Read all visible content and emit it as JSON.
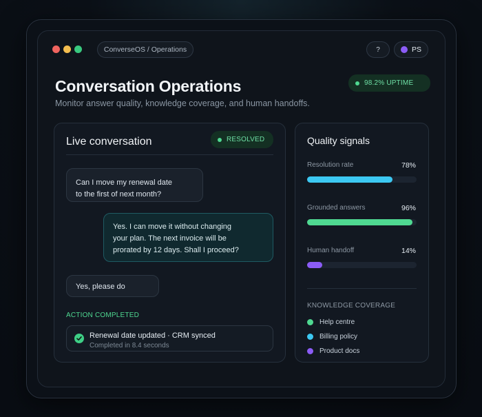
{
  "window": {
    "breadcrumb": "ConverseOS / Operations",
    "help_label": "?",
    "user_initials": "PS"
  },
  "header": {
    "title": "Conversation Operations",
    "subtitle": "Monitor answer quality, knowledge coverage, and human handoffs.",
    "uptime_badge": "98.2% UPTIME"
  },
  "conversation": {
    "title": "Live conversation",
    "status_badge": "RESOLVED",
    "messages": [
      {
        "role": "user",
        "line1": "Can I move my renewal date",
        "line2": "to the first of next month?"
      },
      {
        "role": "agent",
        "line1": "Yes. I can move it without changing",
        "line2": "your plan. The next invoice will be",
        "line3": "prorated by 12 days. Shall I proceed?"
      },
      {
        "role": "user",
        "line1": "Yes, please do"
      }
    ],
    "action_label": "ACTION COMPLETED",
    "action_title": "Renewal date updated · CRM synced",
    "action_subtitle": "Completed in 8.4 seconds"
  },
  "quality": {
    "title": "Quality signals",
    "metrics": [
      {
        "label": "Resolution rate",
        "value": "78%",
        "fraction": 0.78,
        "color": "#3cc8f2"
      },
      {
        "label": "Grounded answers",
        "value": "96%",
        "fraction": 0.96,
        "color": "#4fd891"
      },
      {
        "label": "Human handoff",
        "value": "14%",
        "fraction": 0.14,
        "color": "#8b5cf6"
      }
    ],
    "coverage_label": "KNOWLEDGE COVERAGE",
    "coverage_items": [
      {
        "label": "Help centre",
        "color": "#4fd891"
      },
      {
        "label": "Billing policy",
        "color": "#3cc8f2"
      },
      {
        "label": "Product docs",
        "color": "#8b5cf6"
      }
    ]
  }
}
